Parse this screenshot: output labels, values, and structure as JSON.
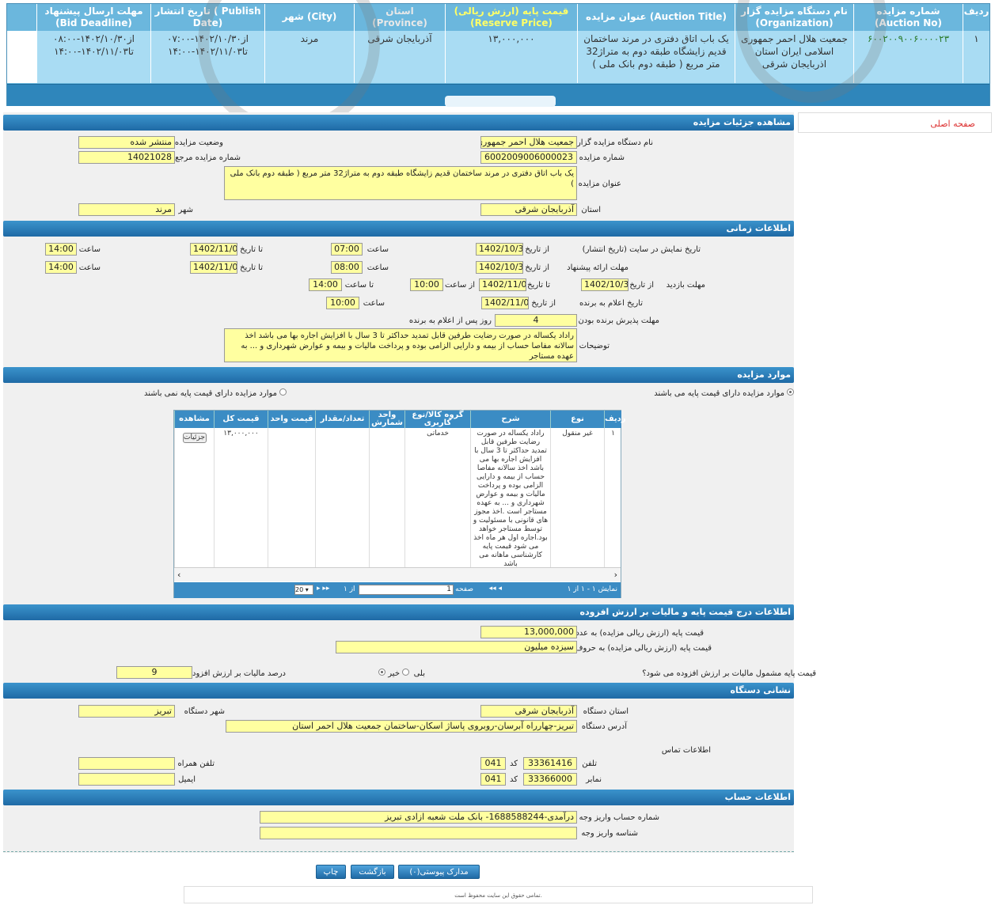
{
  "summary": {
    "headers": [
      {
        "fa": "ردیف",
        "en": ""
      },
      {
        "fa": "شماره مزایده",
        "en": "(Auction No)"
      },
      {
        "fa": "نام دستگاه مزایده گزار",
        "en": "(Organization)"
      },
      {
        "fa": "عنوان مزایده (Auction Title)",
        "en": ""
      },
      {
        "fa": "قیمت پایه (ارزش ریالی)",
        "en": "(Reserve Price)"
      },
      {
        "fa": "استان",
        "en": "(Province)"
      },
      {
        "fa": "شهر (City)",
        "en": ""
      },
      {
        "fa": "تاریخ انتشار ( Publish",
        "en": "Date)"
      },
      {
        "fa": "مهلت ارسال پیشنهاد",
        "en": "(Bid Deadline)"
      }
    ],
    "row": {
      "index": "۱",
      "auction_no": "۶۰۰۲۰۰۹۰۰۶۰۰۰۰۲۳",
      "organization": "جمعیت هلال احمر جمهوری اسلامی ایران استان اذربایجان شرقی",
      "title": "یک باب اتاق دفتری در مرند ساختمان قدیم زایشگاه طبقه دوم به متراژ32 متر مربع ( طبقه دوم بانک ملی )",
      "price": "۱۳,۰۰۰,۰۰۰",
      "province": "آذربایجان شرقی",
      "city": "مرند",
      "publish_from": "از۱۴۰۲/۱۰/۳۰-۰۷:۰۰",
      "publish_to": "تا۱۴۰۲/۱۱/۰۳-۱۴:۰۰",
      "deadline_from": "از۱۴۰۲/۱۰/۳۰-۰۸:۰۰",
      "deadline_to": "تا۱۴۰۲/۱۱/۰۳-۱۴:۰۰"
    }
  },
  "nav": {
    "home_link": "صفحه اصلی"
  },
  "details": {
    "section_title": "مشاهده جزئیات مزایده",
    "org_label": "نام دستگاه مزایده گزار",
    "org_value": "جمعیت هلال احمر جمهوری",
    "status_label": "وضعیت مزایده",
    "status_value": "منتشر شده",
    "auction_no_label": "شماره مزایده",
    "auction_no_value": "6002009006000023",
    "ref_label": "شماره مزایده مرجع",
    "ref_value": "14021028",
    "title_label": "عنوان مزایده",
    "title_value": "یک باب اتاق دفتری در مرند ساختمان قدیم زایشگاه طبقه دوم به متراژ32 متر مربع ( طبقه دوم بانک ملی )",
    "province_label": "استان",
    "province_value": "آذربایجان شرقی",
    "city_label": "شهر",
    "city_value": "مرند"
  },
  "timing": {
    "section_title": "اطلاعات زمانی",
    "display_label": "تاریخ نمایش در سایت (تاریخ انتشار)",
    "from_date_label": "از تاریخ",
    "to_date_label": "تا تاریخ",
    "hour_label": "ساعت",
    "display_from_date": "1402/10/30",
    "display_from_hour": "07:00",
    "display_to_date": "1402/11/03",
    "display_to_hour": "14:00",
    "bid_label": "مهلت ارائه پیشنهاد",
    "bid_from_date": "1402/10/30",
    "bid_from_hour": "08:00",
    "bid_to_date": "1402/11/03",
    "bid_to_hour": "14:00",
    "visit_label": "مهلت بازدید",
    "visit_from_date": "1402/10/30",
    "visit_to_date": "1402/11/02",
    "from_hour_label": "از ساعت",
    "to_hour_label": "تا ساعت",
    "visit_from_hour": "10:00",
    "visit_to_hour": "14:00",
    "winner_label": "تاریخ اعلام به برنده",
    "winner_date": "1402/11/04",
    "winner_hour": "10:00",
    "accept_label": "مهلت پذیرش برنده بودن",
    "accept_value": "4",
    "accept_suffix": "روز پس از اعلام به برنده",
    "notes_label": "توضیحات",
    "notes_value": "راداد یکساله در صورت رضایت طرفین قابل تمدید حداکثر تا 3 سال با افزایش اجاره بها می باشد اخذ سالانه مفاصا حساب از بیمه و دارایی الزامی بوده و پرداخت مالیات و بیمه و عوارض شهرداری و ... به عهده مستاجر"
  },
  "items": {
    "section_title": "موارد مزایده",
    "radio_with_price": "موارد مزایده دارای قیمت پایه می باشند",
    "radio_without_price": "موارد مزایده دارای قیمت پایه نمی باشند",
    "columns": [
      "ردیف",
      "نوع",
      "شرح",
      "گروه کالا/نوع کاربری",
      "واحد شمارش",
      "تعداد/مقدار",
      "قیمت واحد",
      "قیمت کل",
      "مشاهده"
    ],
    "row": {
      "index": "۱",
      "type": "غیر منقول",
      "desc": "راداد یکساله در صورت رضایت طرفین قابل تمدید حداکثر تا 3 سال با افزایش اجاره بها می باشد اخذ سالانه مفاصا حساب از بیمه و دارایی الزامی بوده و پرداخت مالیات و بیمه و عوارض شهرداری و ... به عهده مستاجر است .اخذ مجوز های قانونی با مسئولیت و توسط مستاجر خواهد بود.اجاره اول هر ماه اخذ می شود قیمت پایه کارشناسی ماهانه می باشد",
      "group": "خدماتی",
      "unit": "",
      "qty": "",
      "unit_price": "",
      "total": "۱۳,۰۰۰,۰۰۰",
      "view_button": "جزئیات"
    },
    "pager": {
      "page_label": "صفحه",
      "page_value": "1",
      "of_label": "از ۱",
      "page_size": "20",
      "summary": "نمایش ۱ - ۱ از ۱"
    }
  },
  "price": {
    "section_title": "اطلاعات درج قیمت پایه و مالیات بر ارزش افزوده",
    "number_label": "قیمت پایه (ارزش ریالی مزایده) به عدد",
    "number_value": "13,000,000",
    "words_label": "قیمت پایه (ارزش ریالی مزایده) به حروف",
    "words_value": "سیزده میلیون",
    "vat_question": "قیمت پایه مشمول مالیات بر ارزش افزوده می شود؟",
    "yes_label": "بلی",
    "no_label": "خیر",
    "vat_percent_label": "درصد مالیات بر ارزش افزوده",
    "vat_percent_value": "9"
  },
  "address": {
    "section_title": "نشانی دستگاه",
    "province_label": "استان دستگاه",
    "province_value": "آذربایجان شرقی",
    "city_label": "شهر دستگاه",
    "city_value": "تبریز",
    "address_label": "آدرس دستگاه",
    "address_value": "تبریز-چهارراه آبرسان-روبروی پاساژ اسکان-ساختمان جمعیت هلال احمر استان",
    "contact_label": "اطلاعات تماس",
    "phone_label": "تلفن",
    "code_label": "کد",
    "phone_value": "33361416",
    "phone_code": "041",
    "fax_label": "نمابر",
    "fax_value": "33366000",
    "fax_code": "041",
    "mobile_label": "تلفن همراه",
    "mobile_value": "",
    "email_label": "ایمیل",
    "email_value": ""
  },
  "account": {
    "section_title": "اطلاعات حساب",
    "account_label": "شماره حساب واریز وجه",
    "account_value": "درآمدی-1688588244- بانک ملت شعبه ازادی تبریز",
    "id_label": "شناسه واریز وجه",
    "id_value": ""
  },
  "actions": {
    "attachments": "مدارک پیوستی(۰)",
    "back": "بازگشت",
    "print": "چاپ"
  },
  "footer": {
    "copyright": "تمامی حقوق این سایت محفوظ است."
  },
  "colors": {
    "header_blue": "#2c7fb8",
    "field_yellow": "#ffffa0",
    "summary_blue": "#6bb7dd"
  }
}
